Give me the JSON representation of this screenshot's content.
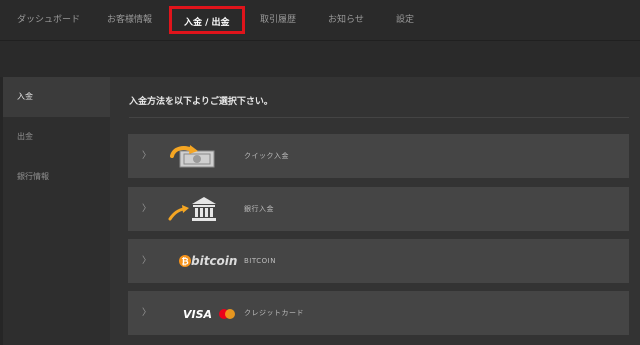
{
  "nav": {
    "items": [
      {
        "label": "ダッシュボード"
      },
      {
        "label": "お客様情報"
      },
      {
        "label": "入金 / 出金"
      },
      {
        "label": "取引履歴"
      },
      {
        "label": "お知らせ"
      },
      {
        "label": "設定"
      }
    ],
    "active_index": 2
  },
  "sidebar": {
    "items": [
      {
        "label": "入金"
      },
      {
        "label": "出金"
      },
      {
        "label": "銀行情報"
      }
    ],
    "active_index": 0
  },
  "main": {
    "heading": "入金方法を以下よりご選択下さい。",
    "methods": [
      {
        "label": "クイック入金",
        "icon": "cash-transfer-icon"
      },
      {
        "label": "銀行入金",
        "icon": "bank-icon"
      },
      {
        "label": "BITCOIN",
        "icon": "bitcoin-logo",
        "logo_text": "bitcoin"
      },
      {
        "label": "クレジットカード",
        "icon": "visa-mastercard-logo",
        "logo_text": "VISA"
      }
    ]
  },
  "colors": {
    "active_outline": "#e0141b",
    "accent_gold": "#f5a623",
    "bitcoin_orange": "#f7931a"
  }
}
